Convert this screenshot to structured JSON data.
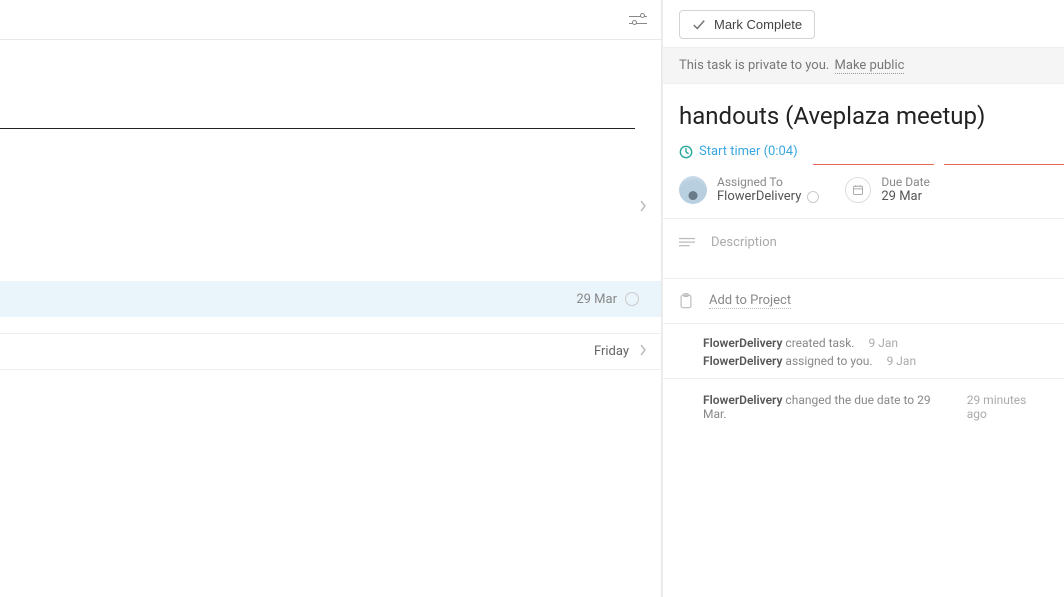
{
  "left": {
    "highlighted_date": "29 Mar",
    "group_label": "Friday"
  },
  "task": {
    "mark_complete_label": "Mark Complete",
    "privacy_text": "This task is private to you.",
    "make_public_label": "Make public",
    "title": "handouts (Aveplaza meetup)",
    "timer_label": "Start timer (0:04)",
    "assigned_to_label": "Assigned To",
    "assignee": "FlowerDelivery",
    "due_date_label": "Due Date",
    "due_date": "29 Mar",
    "description_label": "Description",
    "add_to_project_label": "Add to Project"
  },
  "activity": [
    {
      "actor": "FlowerDelivery",
      "text": "created task.",
      "ts": "9 Jan"
    },
    {
      "actor": "FlowerDelivery",
      "text": "assigned to you.",
      "ts": "9 Jan"
    }
  ],
  "activity2": [
    {
      "actor": "FlowerDelivery",
      "text": "changed the due date to 29 Mar.",
      "ts": "29 minutes ago"
    }
  ]
}
